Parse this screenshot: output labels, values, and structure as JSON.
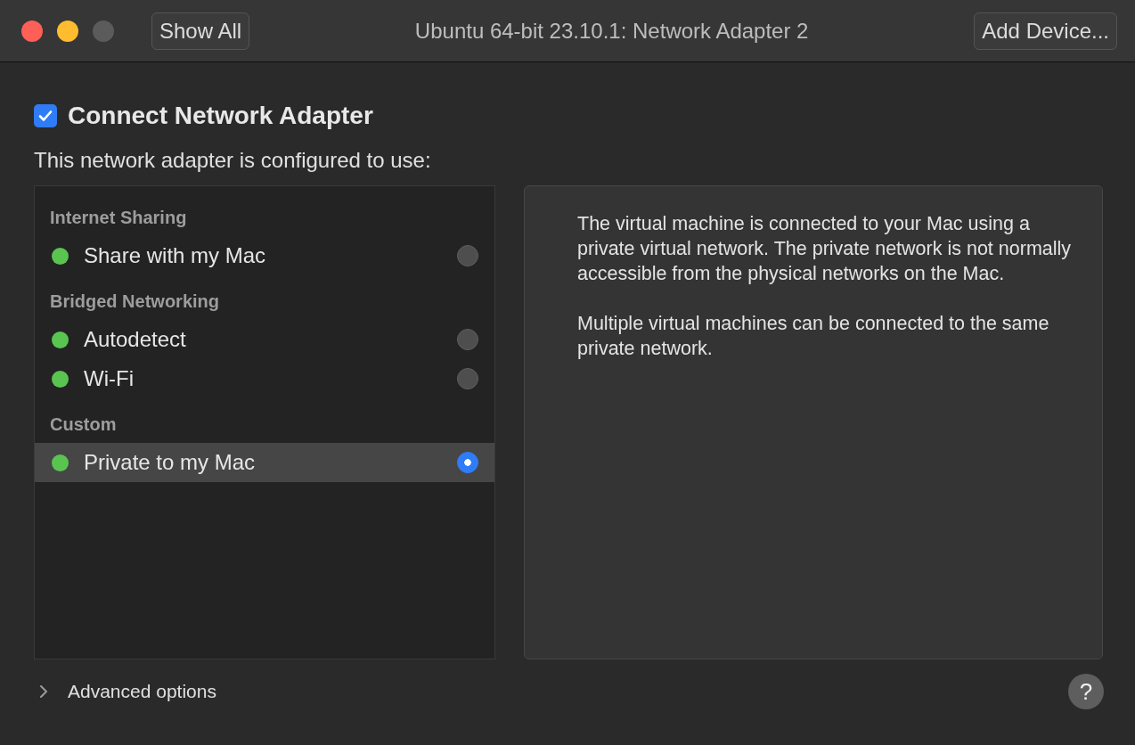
{
  "window": {
    "title": "Ubuntu 64-bit 23.10.1: Network Adapter 2"
  },
  "toolbar": {
    "show_all": "Show All",
    "add_device": "Add Device..."
  },
  "connect": {
    "label": "Connect Network Adapter",
    "checked": true
  },
  "subtitle": "This network adapter is configured to use:",
  "groups": [
    {
      "heading": "Internet Sharing",
      "items": [
        {
          "name": "Share with my Mac",
          "color": "#5ac451",
          "selected": false
        }
      ]
    },
    {
      "heading": "Bridged Networking",
      "items": [
        {
          "name": "Autodetect",
          "color": "#5ac451",
          "selected": false
        },
        {
          "name": "Wi-Fi",
          "color": "#5ac451",
          "selected": false
        }
      ]
    },
    {
      "heading": "Custom",
      "items": [
        {
          "name": "Private to my Mac",
          "color": "#5ac451",
          "selected": true
        }
      ]
    }
  ],
  "description": [
    "The virtual machine is connected to your Mac using a private virtual network. The private network is not normally accessible from the physical networks on the Mac.",
    "Multiple virtual machines can be connected to the same private network."
  ],
  "advanced": {
    "label": "Advanced options",
    "expanded": false
  },
  "help": "?"
}
